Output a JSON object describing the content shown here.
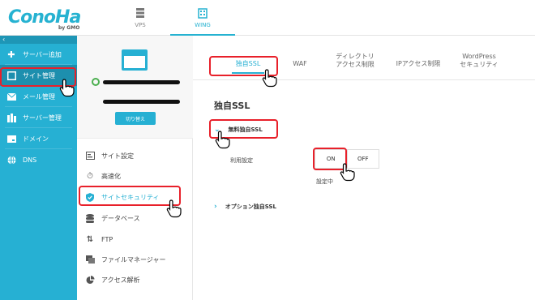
{
  "logo": {
    "text": "ConoHa",
    "sub": "by GMO"
  },
  "topnav": [
    {
      "label": "VPS",
      "icon": "server-icon",
      "active": false
    },
    {
      "label": "WING",
      "icon": "building-icon",
      "active": true
    }
  ],
  "sidebar": {
    "items": [
      {
        "label": "サーバー追加",
        "icon": "plus-icon"
      },
      {
        "label": "サイト管理",
        "icon": "window-icon",
        "selected": true
      },
      {
        "label": "メール管理",
        "icon": "mail-icon"
      },
      {
        "label": "サーバー管理",
        "icon": "server-icon"
      },
      {
        "label": "ドメイン",
        "icon": "domain-icon"
      },
      {
        "label": "DNS",
        "icon": "globe-icon"
      }
    ]
  },
  "panel": {
    "switch_label": "切り替え",
    "menu": [
      {
        "label": "サイト設定",
        "icon": "settings-icon"
      },
      {
        "label": "高速化",
        "icon": "stopwatch-icon"
      },
      {
        "label": "サイトセキュリティ",
        "icon": "shield-icon",
        "active": true
      },
      {
        "label": "データベース",
        "icon": "database-icon"
      },
      {
        "label": "FTP",
        "icon": "transfer-icon"
      },
      {
        "label": "ファイルマネージャー",
        "icon": "folder-icon"
      },
      {
        "label": "アクセス解析",
        "icon": "pie-chart-icon"
      }
    ]
  },
  "main": {
    "tabs": [
      {
        "line1": "独自SSL",
        "line2": "",
        "active": true
      },
      {
        "line1": "WAF",
        "line2": ""
      },
      {
        "line1": "ディレクトリ",
        "line2": "アクセス制限"
      },
      {
        "line1": "IPアクセス制限",
        "line2": ""
      },
      {
        "line1": "WordPress",
        "line2": "セキュリティ"
      }
    ],
    "title": "独自SSL",
    "free_ssl": "無料独自SSL",
    "usage_label": "利用設定",
    "on_label": "ON",
    "off_label": "OFF",
    "status_text": "設定中",
    "option_ssl": "オプション独自SSL"
  },
  "colors": {
    "accent": "#26b0d3",
    "highlight": "#e8202a"
  }
}
